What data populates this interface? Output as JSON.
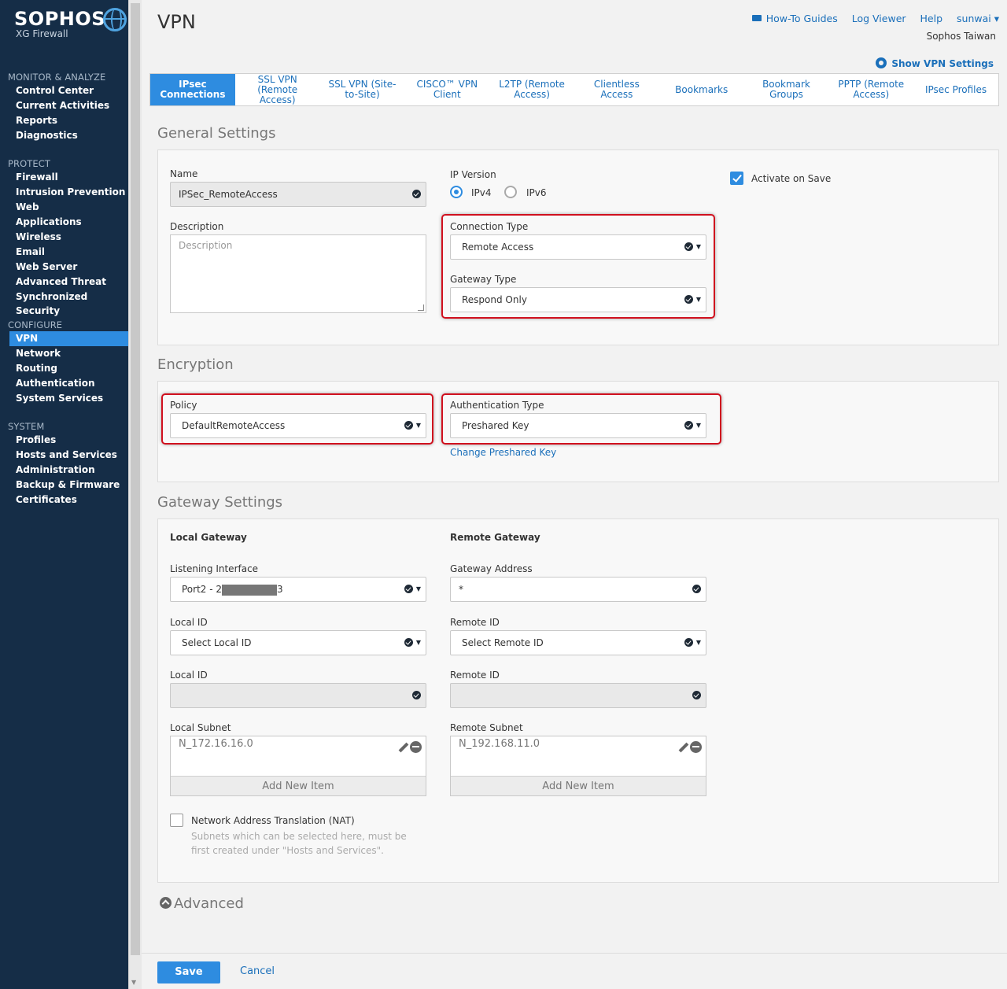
{
  "brand": {
    "name": "SOPHOS",
    "product": "XG Firewall"
  },
  "sidebar": {
    "sections": [
      {
        "title": "MONITOR & ANALYZE",
        "items": [
          "Control Center",
          "Current Activities",
          "Reports",
          "Diagnostics"
        ]
      },
      {
        "title": "PROTECT",
        "items": [
          "Firewall",
          "Intrusion Prevention",
          "Web",
          "Applications",
          "Wireless",
          "Email",
          "Web Server",
          "Advanced Threat",
          "Synchronized Security"
        ]
      },
      {
        "title": "CONFIGURE",
        "items": [
          "VPN",
          "Network",
          "Routing",
          "Authentication",
          "System Services"
        ]
      },
      {
        "title": "SYSTEM",
        "items": [
          "Profiles",
          "Hosts and Services",
          "Administration",
          "Backup & Firmware",
          "Certificates"
        ]
      }
    ],
    "active_item": "VPN"
  },
  "header": {
    "title": "VPN",
    "links": [
      "How-To Guides",
      "Log Viewer",
      "Help",
      "sunwai ▾"
    ],
    "org": "Sophos Taiwan",
    "show_settings": "Show VPN Settings"
  },
  "tabs": [
    {
      "label": "IPsec Connections",
      "active": true
    },
    {
      "label": "SSL VPN (Remote Access)"
    },
    {
      "label": "SSL VPN (Site-to-Site)"
    },
    {
      "label": "CISCO™ VPN Client"
    },
    {
      "label": "L2TP (Remote Access)"
    },
    {
      "label": "Clientless Access"
    },
    {
      "label": "Bookmarks"
    },
    {
      "label": "Bookmark Groups"
    },
    {
      "label": "PPTP (Remote Access)"
    },
    {
      "label": "IPsec Profiles"
    }
  ],
  "general": {
    "heading": "General Settings",
    "name_label": "Name",
    "name_value": "IPSec_RemoteAccess",
    "ip_version_label": "IP Version",
    "ipv4": "IPv4",
    "ipv6": "IPv6",
    "ip_version_selected": "IPv4",
    "activate_label": "Activate on Save",
    "activate_checked": true,
    "description_label": "Description",
    "description_placeholder": "Description",
    "connection_type_label": "Connection Type",
    "connection_type_value": "Remote Access",
    "gateway_type_label": "Gateway Type",
    "gateway_type_value": "Respond Only"
  },
  "encryption": {
    "heading": "Encryption",
    "policy_label": "Policy",
    "policy_value": "DefaultRemoteAccess",
    "auth_type_label": "Authentication Type",
    "auth_type_value": "Preshared Key",
    "change_key_link": "Change Preshared Key"
  },
  "gateway": {
    "heading": "Gateway Settings",
    "local_heading": "Local Gateway",
    "remote_heading": "Remote Gateway",
    "listening_interface_label": "Listening Interface",
    "listening_interface_prefix": "Port2 - 2",
    "listening_interface_suffix": "3",
    "gateway_address_label": "Gateway Address",
    "gateway_address_value": "*",
    "local_id_label": "Local ID",
    "local_id_select": "Select Local ID",
    "remote_id_label": "Remote ID",
    "remote_id_select": "Select Remote ID",
    "local_subnet_label": "Local Subnet",
    "local_subnet_item": "N_172.16.16.0",
    "remote_subnet_label": "Remote Subnet",
    "remote_subnet_item": "N_192.168.11.0",
    "add_new_item": "Add New Item",
    "nat_label": "Network Address Translation (NAT)",
    "nat_checked": false,
    "nat_help_1": "Subnets which can be selected here, must be",
    "nat_help_2": "first created under \"Hosts and Services\"."
  },
  "advanced_label": "Advanced",
  "footer": {
    "save": "Save",
    "cancel": "Cancel"
  },
  "colors": {
    "accent": "#2e8ce0",
    "sidebar": "#152d47",
    "highlight": "#d0101e"
  }
}
